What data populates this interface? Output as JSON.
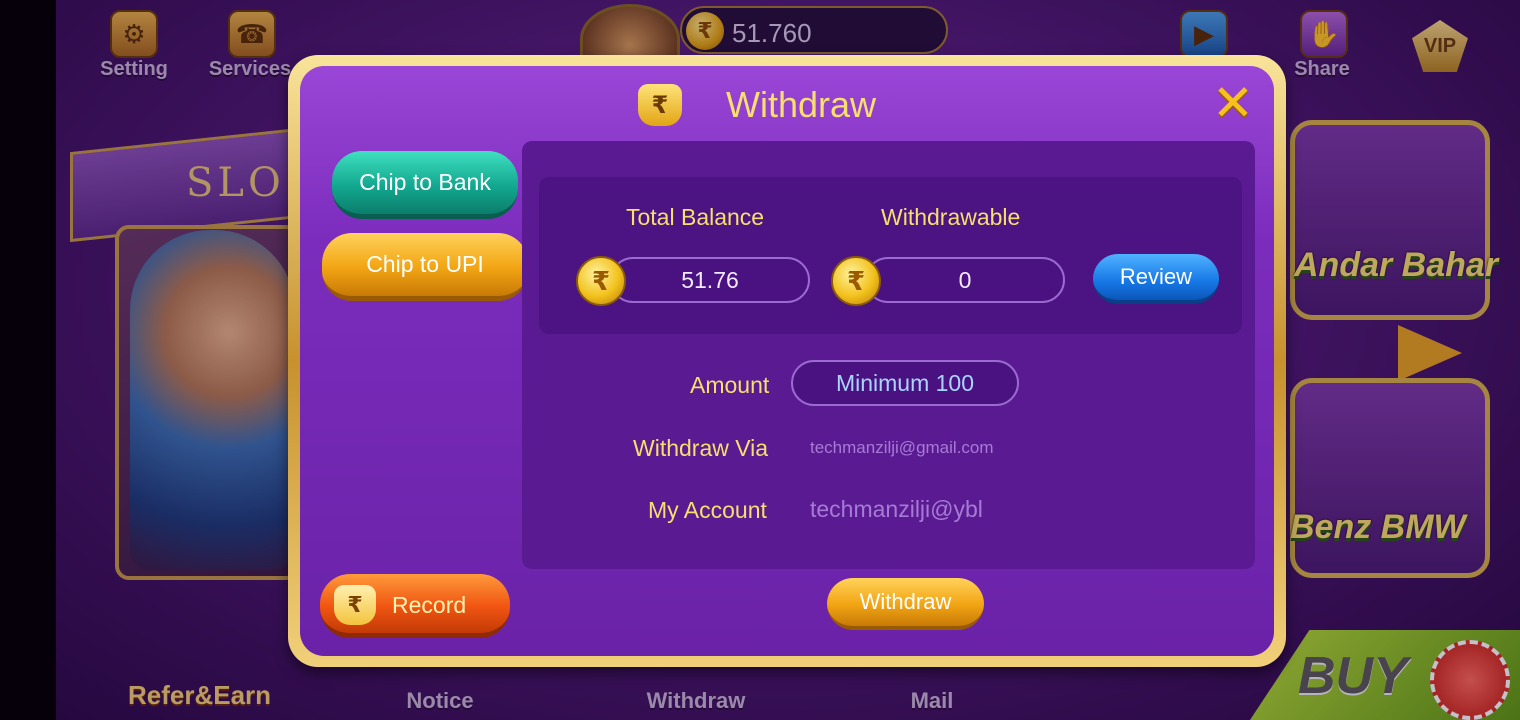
{
  "top_bar": {
    "setting_label": "Setting",
    "services_label": "Services",
    "balance": "51.760",
    "share_label": "Share",
    "vip_label": "VIP"
  },
  "background": {
    "slots_banner": "SLO",
    "refer_label": "Refer&Earn",
    "andar_bahar_label": "Andar Bahar",
    "benz_bmw_label": "Benz BMW",
    "buy_label": "BUY"
  },
  "bottom_nav": {
    "notice_label": "Notice",
    "withdraw_label": "Withdraw",
    "mail_label": "Mail"
  },
  "modal": {
    "title": "Withdraw",
    "tabs": [
      {
        "label": "Chip to Bank",
        "active": false
      },
      {
        "label": "Chip to UPI",
        "active": true
      }
    ],
    "total_balance_label": "Total Balance",
    "total_balance_value": "51.76",
    "withdrawable_label": "Withdrawable",
    "withdrawable_value": "0",
    "review_label": "Review",
    "amount_label": "Amount",
    "amount_placeholder": "Minimum 100",
    "withdraw_via_label": "Withdraw Via",
    "withdraw_via_value": "techmanzilji@gmail.com",
    "my_account_label": "My Account",
    "my_account_value": "techmanzilji@ybl",
    "record_label": "Record",
    "withdraw_button_label": "Withdraw",
    "currency_symbol": "₹",
    "close_symbol": "✕"
  },
  "colors": {
    "accent_gold": "#f7df6d",
    "teal_tab": "#13a890",
    "orange_tab": "#f2a514",
    "review_blue": "#1677e6"
  }
}
